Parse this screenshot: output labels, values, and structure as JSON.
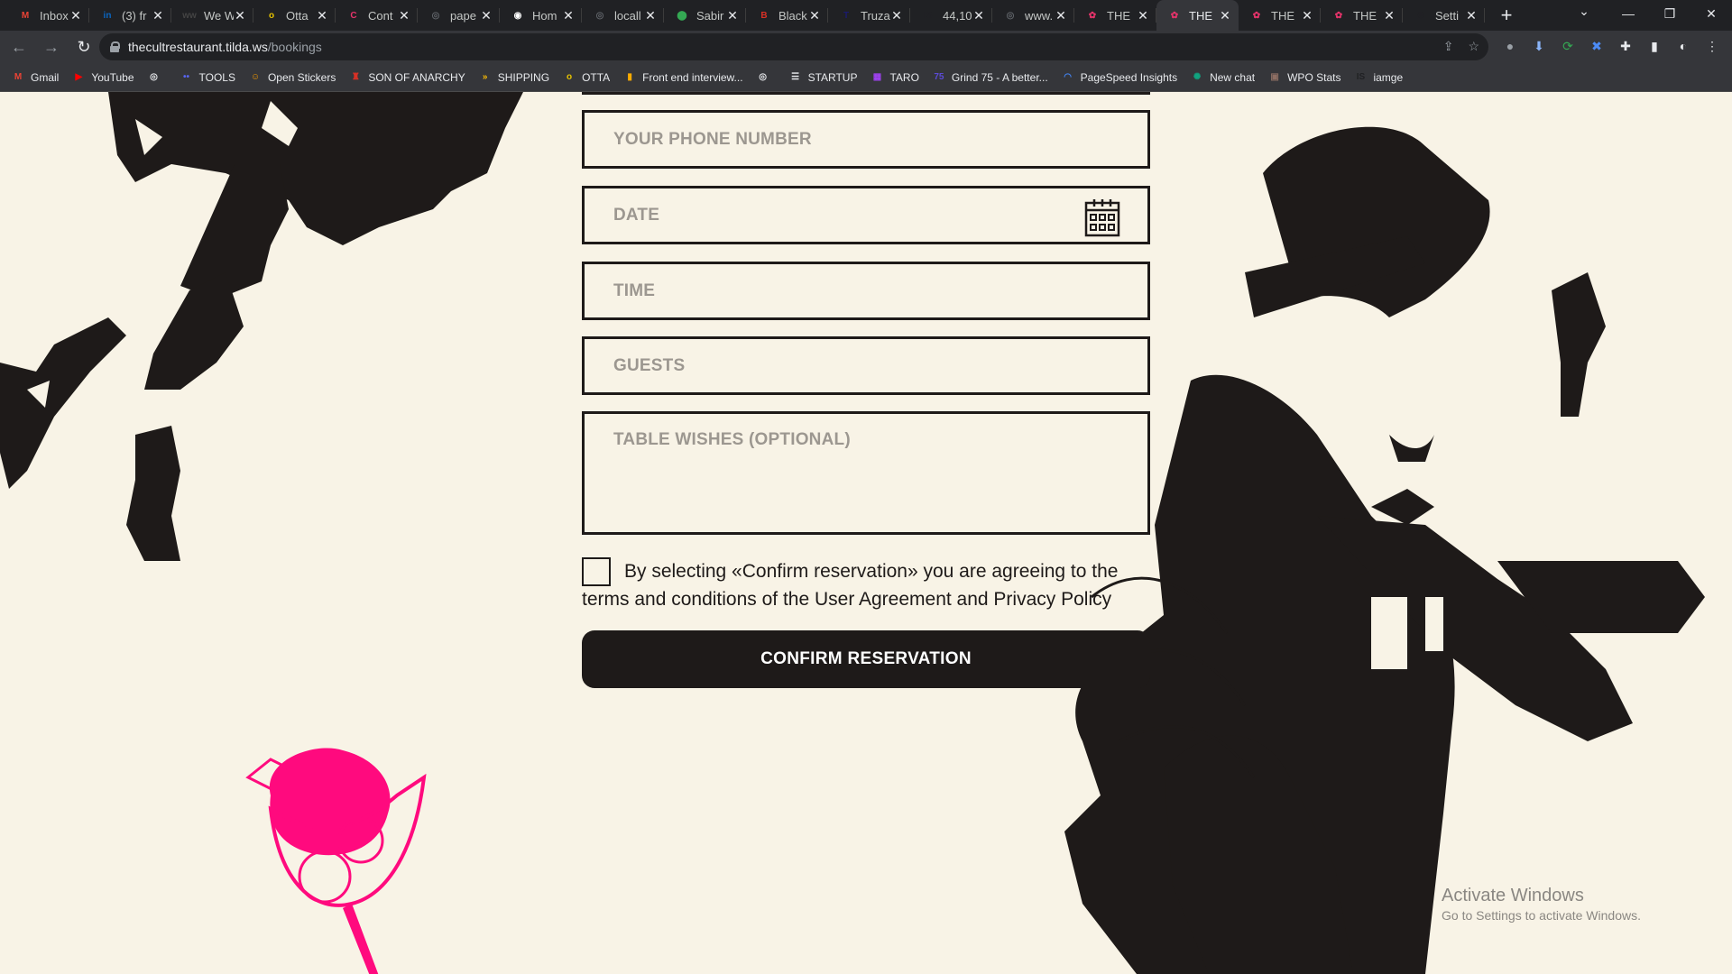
{
  "browser": {
    "tabs": [
      {
        "label": "Inbox",
        "icon": "gmail-icon",
        "color": "#ea4335",
        "glyph": "M"
      },
      {
        "label": "(3) fr",
        "icon": "linkedin-icon",
        "color": "#0a66c2",
        "glyph": "in"
      },
      {
        "label": "We W",
        "icon": "weworkremotely-icon",
        "color": "#444444",
        "glyph": "ww"
      },
      {
        "label": "Otta",
        "icon": "otta-icon",
        "color": "#e6c200",
        "glyph": "o"
      },
      {
        "label": "Cont",
        "icon": "cont-icon",
        "color": "#e8336b",
        "glyph": "C"
      },
      {
        "label": "pape",
        "icon": "globe-icon",
        "color": "#5f6368",
        "glyph": "◎"
      },
      {
        "label": "Hom",
        "icon": "github-icon",
        "color": "#ffffff",
        "glyph": "◉"
      },
      {
        "label": "locall",
        "icon": "globe-icon",
        "color": "#5f6368",
        "glyph": "◎"
      },
      {
        "label": "Sabir",
        "icon": "maps-pin-icon",
        "color": "#34a853",
        "glyph": "⬤"
      },
      {
        "label": "Black",
        "icon": "black-icon",
        "color": "#d93025",
        "glyph": "B"
      },
      {
        "label": "Truza",
        "icon": "truza-icon",
        "color": "#1a1a6e",
        "glyph": "T"
      },
      {
        "label": "44,10",
        "icon": "is-icon",
        "color": "#202124",
        "glyph": "IS"
      },
      {
        "label": "www.",
        "icon": "globe-icon",
        "color": "#5f6368",
        "glyph": "◎"
      },
      {
        "label": "THE",
        "icon": "tilda-icon",
        "color": "#e8336b",
        "glyph": "✿"
      },
      {
        "label": "THE",
        "icon": "tilda-icon",
        "color": "#e8336b",
        "glyph": "✿"
      },
      {
        "label": "THE",
        "icon": "tilda-icon",
        "color": "#e8336b",
        "glyph": "✿"
      },
      {
        "label": "THE",
        "icon": "tilda-icon",
        "color": "#e8336b",
        "glyph": "✿"
      },
      {
        "label": "Setti",
        "icon": "gear-icon",
        "color": "#202124",
        "glyph": "⚙"
      }
    ],
    "active_tab_index": 14,
    "tab_close": "✕",
    "new_tab": "+",
    "url_host": "thecultrestaurant.tilda.ws",
    "url_path": "/bookings",
    "bookmarks": [
      {
        "label": "Gmail",
        "icon": "gmail-icon",
        "color": "#ea4335",
        "glyph": "M"
      },
      {
        "label": "YouTube",
        "icon": "youtube-icon",
        "color": "#ff0000",
        "glyph": "▶"
      },
      {
        "label": "",
        "icon": "globe-icon",
        "color": "#e8eaed",
        "glyph": "◎"
      },
      {
        "label": "TOOLS",
        "icon": "tools-icon",
        "color": "#5865f2",
        "glyph": "••"
      },
      {
        "label": "Open Stickers",
        "icon": "sticker-icon",
        "color": "#f29900",
        "glyph": "☺"
      },
      {
        "label": "SON OF ANARCHY",
        "icon": "anarchy-icon",
        "color": "#d93025",
        "glyph": "♜"
      },
      {
        "label": "SHIPPING",
        "icon": "shipping-icon",
        "color": "#fbbc04",
        "glyph": "»"
      },
      {
        "label": "OTTA",
        "icon": "otta-icon",
        "color": "#e6c200",
        "glyph": "o"
      },
      {
        "label": "Front end interview...",
        "icon": "folder-icon",
        "color": "#f9ab00",
        "glyph": "▮"
      },
      {
        "label": "",
        "icon": "globe-icon",
        "color": "#e8eaed",
        "glyph": "◎"
      },
      {
        "label": "STARTUP",
        "icon": "startup-icon",
        "color": "#e8eaed",
        "glyph": "☰"
      },
      {
        "label": "TARO",
        "icon": "taro-icon",
        "color": "#a142f4",
        "glyph": "▦"
      },
      {
        "label": "Grind 75 - A better...",
        "icon": "grind-icon",
        "color": "#5b4bd6",
        "glyph": "75"
      },
      {
        "label": "PageSpeed Insights",
        "icon": "pagespeed-icon",
        "color": "#4285f4",
        "glyph": "◠"
      },
      {
        "label": "New chat",
        "icon": "chatgpt-icon",
        "color": "#10a37f",
        "glyph": "✺"
      },
      {
        "label": "WPO Stats",
        "icon": "wpo-icon",
        "color": "#8d6e63",
        "glyph": "▣"
      },
      {
        "label": "iamge",
        "icon": "is-icon",
        "color": "#202124",
        "glyph": "IS"
      }
    ]
  },
  "form": {
    "phone_placeholder": "YOUR PHONE NUMBER",
    "date_placeholder": "DATE",
    "time_placeholder": "TIME",
    "guests_placeholder": "GUESTS",
    "wishes_placeholder": "TABLE WISHES (OPTIONAL)",
    "consent_text": "By selecting «Confirm reservation» you are agreeing to the terms and conditions of the User Agreement and Privacy Policy",
    "confirm_label": "CONFIRM RESERVATION"
  },
  "colors": {
    "page_bg": "#f8f3e6",
    "ink": "#1e1a19",
    "accent_pink": "#ff0a7e",
    "placeholder": "#9c9790"
  },
  "watermark": {
    "title": "Activate Windows",
    "subtitle": "Go to Settings to activate Windows."
  }
}
